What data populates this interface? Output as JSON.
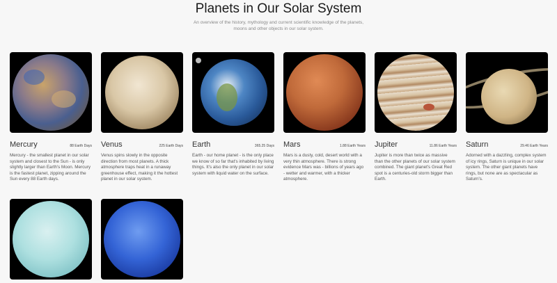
{
  "header": {
    "title": "Planets in Our Solar System",
    "subtitle": "An overview of the history, mythology and current scientific knowledge of the planets, moons and other objects in our solar system."
  },
  "planets": [
    {
      "name": "Mercury",
      "days": "88 Earth Days",
      "desc": "Mercury - the smallest planet in our solar system and closest to the Sun - is only slightly larger than Earth's Moon. Mercury is the fastest planet, zipping around the Sun every 88 Earth days.",
      "icon": "mercury-image"
    },
    {
      "name": "Venus",
      "days": "225 Earth Days",
      "desc": "Venus spins slowly in the opposite direction from most planets. A thick atmosphere traps heat in a runaway greenhouse effect, making it the hottest planet in our solar system.",
      "icon": "venus-image"
    },
    {
      "name": "Earth",
      "days": "365.25 Days",
      "desc": "Earth - our home planet - is the only place we know of so far that's inhabited by living things. It's also the only planet in our solar system with liquid water on the surface.",
      "icon": "earth-image"
    },
    {
      "name": "Mars",
      "days": "1.88 Earth Years",
      "desc": "Mars is a dusty, cold, desert world with a very thin atmosphere. There is strong evidence Mars was - billions of years ago - wetter and warmer, with a thicker atmosphere.",
      "icon": "mars-image"
    },
    {
      "name": "Jupiter",
      "days": "11.86 Earth Years",
      "desc": "Jupiter is more than twice as massive than the other planets of our solar system combined. The giant planet's Great Red spot is a centuries-old storm bigger than Earth.",
      "icon": "jupiter-image"
    },
    {
      "name": "Saturn",
      "days": "29.46 Earth Years",
      "desc": "Adorned with a dazzling, complex system of icy rings, Saturn is unique in our solar system. The other giant planets have rings, but none are as spectacular as Saturn's.",
      "icon": "saturn-image"
    },
    {
      "name": "",
      "days": "",
      "desc": "",
      "icon": "uranus-image"
    },
    {
      "name": "",
      "days": "",
      "desc": "",
      "icon": "neptune-image"
    }
  ]
}
